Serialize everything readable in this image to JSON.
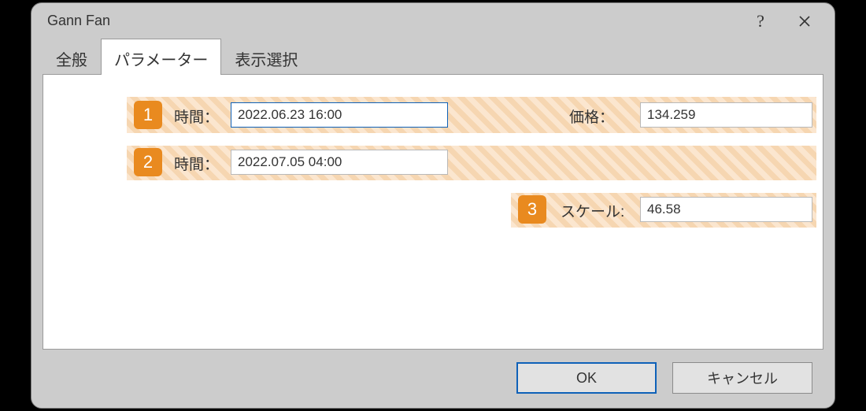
{
  "dialog": {
    "title": "Gann Fan"
  },
  "tabs": {
    "general": "全般",
    "parameters": "パラメーター",
    "display": "表示選択"
  },
  "badges": {
    "b1": "1",
    "b2": "2",
    "b3": "3"
  },
  "labels": {
    "time": "時間：",
    "price": "価格：",
    "scale": "スケール:"
  },
  "values": {
    "time1": "2022.06.23 16:00",
    "time2": "2022.07.05 04:00",
    "price": "134.259",
    "scale": "46.58"
  },
  "buttons": {
    "ok": "OK",
    "cancel": "キャンセル"
  }
}
